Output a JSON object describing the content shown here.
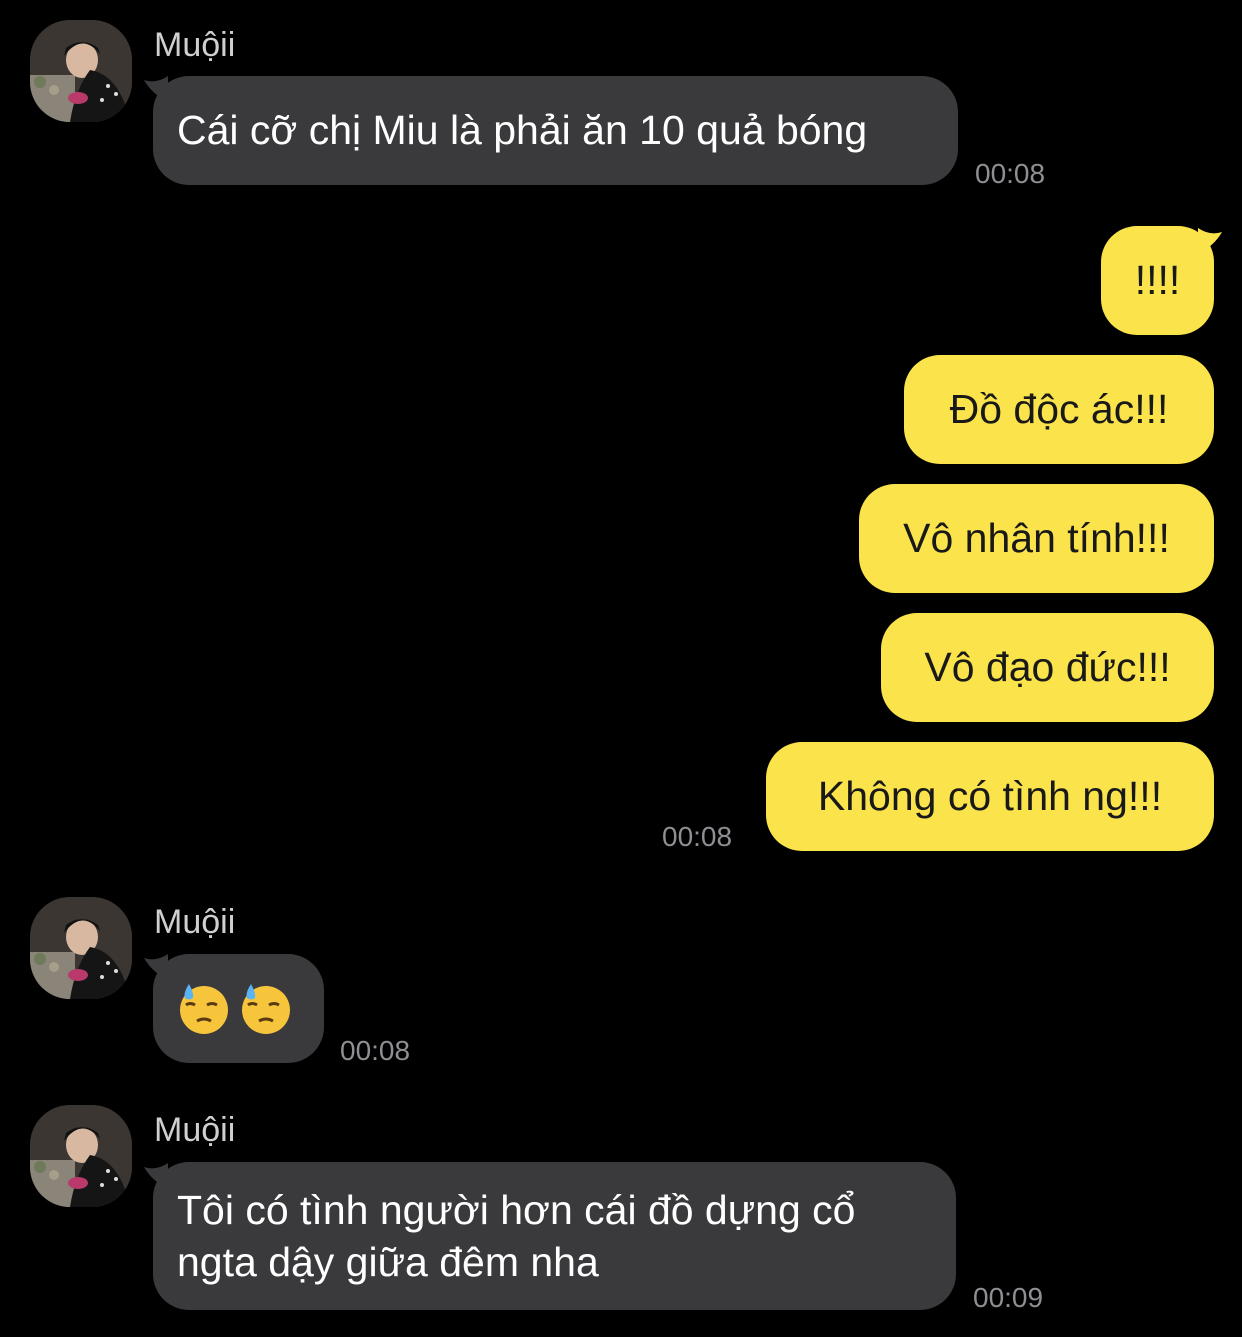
{
  "colors": {
    "background": "#000000",
    "incoming_bubble": "#3a3a3c",
    "outgoing_bubble": "#fbe44b",
    "timestamp": "#8e8e93",
    "sender_name": "#cfcfcf"
  },
  "messages": [
    {
      "direction": "incoming",
      "sender": "Muộii",
      "avatar_icon": "profile-photo-icon",
      "text": "Cái cỡ chị Miu là phải ăn 10 quả bóng",
      "time": "00:08"
    },
    {
      "direction": "outgoing",
      "group": [
        {
          "text": "!!!!"
        },
        {
          "text": "Đồ độc ác!!!"
        },
        {
          "text": "Vô nhân tính!!!"
        },
        {
          "text": "Vô đạo đức!!!"
        },
        {
          "text": "Không có tình ng!!!"
        }
      ],
      "time": "00:08"
    },
    {
      "direction": "incoming",
      "sender": "Muộii",
      "avatar_icon": "profile-photo-icon",
      "emojis": [
        "downcast-face-with-sweat-icon",
        "downcast-face-with-sweat-icon"
      ],
      "time": "00:08"
    },
    {
      "direction": "incoming",
      "sender": "Muộii",
      "avatar_icon": "profile-photo-icon",
      "text_lines": [
        "Tôi có tình người hơn cái đồ dựng cổ",
        "ngta dậy giữa đêm nha"
      ],
      "time": "00:09"
    }
  ]
}
